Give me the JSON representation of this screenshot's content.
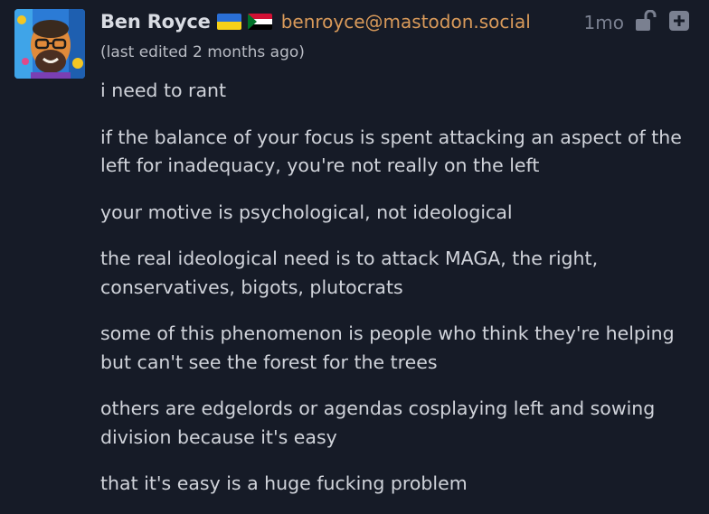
{
  "post": {
    "author": {
      "display_name": "Ben Royce",
      "flags": [
        "ukraine-flag",
        "sudan-flag"
      ],
      "handle": "benroyce@mastodon.social",
      "avatar": "avatar-image"
    },
    "timestamp": "1mo",
    "visibility_icon": "unlocked-icon",
    "action_icon": "plus-box-icon",
    "edited_note": "(last edited 2 months ago)",
    "paragraphs": [
      "i need to rant",
      "if the balance of your focus is spent attacking an aspect of the left for inadequacy, you're not really on the left",
      "your motive is psychological, not ideological",
      "the real ideological need is to attack MAGA, the right, conservatives, bigots, plutocrats",
      "some of this phenomenon is people who think they're helping but can't see the forest for the trees",
      "others are edgelords or agendas cosplaying left and sowing division because it's easy",
      "that it's easy is a huge fucking problem"
    ]
  },
  "colors": {
    "background": "#161b27",
    "text": "#d0d3da",
    "handle": "#d99a5a",
    "muted": "#7a8090"
  }
}
